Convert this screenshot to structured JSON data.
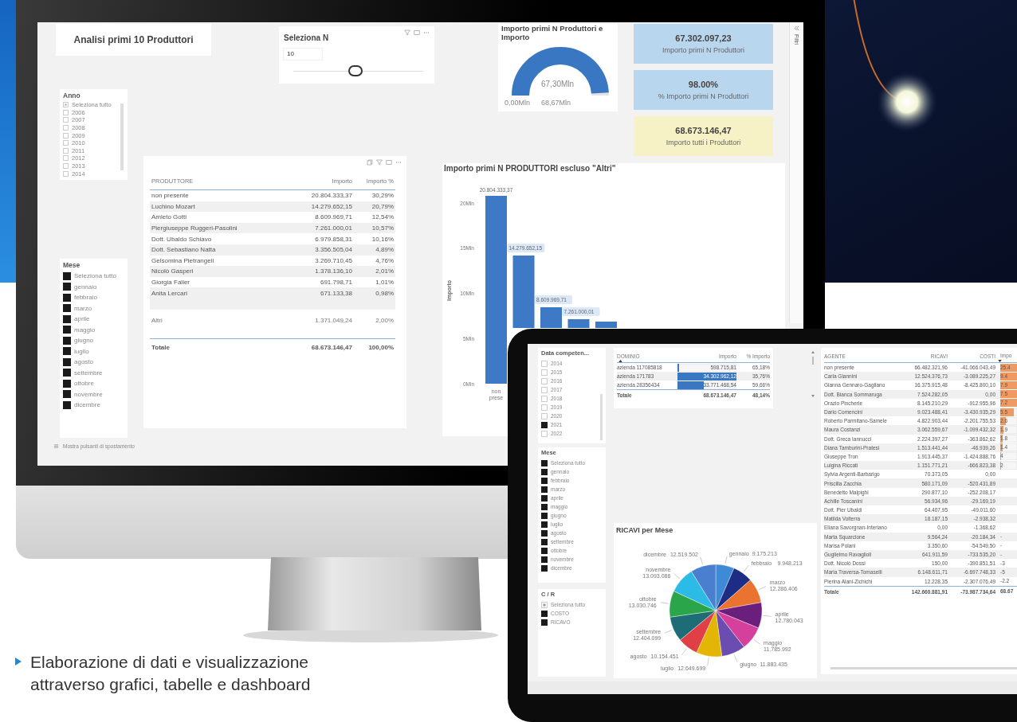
{
  "monitor": {
    "title_card": "Analisi primi 10 Produttori",
    "n_selector": {
      "title": "Seleziona N",
      "value": "10",
      "level": 0.48
    },
    "gauge": {
      "title": "Importo primi N Produttori e Importo",
      "value": "67,30Mln",
      "min": "0,00Mln",
      "max": "68,67Mln",
      "level": 0.98
    },
    "kpi_cards": [
      {
        "value": "67.302.097,23",
        "label": "Importo primi N Produttori",
        "kind": "partial"
      },
      {
        "value": "98.00%",
        "label": "% Importo primi N Produttori",
        "kind": "partial"
      },
      {
        "value": "68.673.146,47",
        "label": "Importo tutti i Produttori",
        "kind": "total"
      }
    ],
    "filters_pane": {
      "label": "Filtri"
    },
    "year_slicer": {
      "title": "Anno",
      "items": [
        {
          "label": "Seleziona tutto",
          "checked": false,
          "indeterminate": true
        },
        {
          "label": "2006",
          "checked": false,
          "indeterminate": false
        },
        {
          "label": "2007",
          "checked": false,
          "indeterminate": false
        },
        {
          "label": "2008",
          "checked": false,
          "indeterminate": false
        },
        {
          "label": "2009",
          "checked": false,
          "indeterminate": false
        },
        {
          "label": "2010",
          "checked": false,
          "indeterminate": false
        },
        {
          "label": "2011",
          "checked": false,
          "indeterminate": false
        },
        {
          "label": "2012",
          "checked": false,
          "indeterminate": false
        },
        {
          "label": "2013",
          "checked": false,
          "indeterminate": false
        },
        {
          "label": "2014",
          "checked": false,
          "indeterminate": false
        }
      ]
    },
    "month_slicer": {
      "title": "Mese",
      "items": [
        {
          "label": "Seleziona tutto",
          "checked": true
        },
        {
          "label": "gennaio",
          "checked": true
        },
        {
          "label": "febbraio",
          "checked": true
        },
        {
          "label": "marzo",
          "checked": true
        },
        {
          "label": "aprile",
          "checked": true
        },
        {
          "label": "maggio",
          "checked": true
        },
        {
          "label": "giugno",
          "checked": true
        },
        {
          "label": "luglio",
          "checked": true
        },
        {
          "label": "agosto",
          "checked": true
        },
        {
          "label": "settembre",
          "checked": true
        },
        {
          "label": "ottobre",
          "checked": true
        },
        {
          "label": "novembre",
          "checked": true
        },
        {
          "label": "dicembre",
          "checked": true
        }
      ]
    },
    "table": {
      "columns": [
        "PRODUTTORE",
        "Importo",
        "Importo %"
      ],
      "rows": [
        [
          "non presente",
          "20.804.333,37",
          "30,29%"
        ],
        [
          "Luchino Mozart",
          "14.279.652,15",
          "20,79%"
        ],
        [
          "Amleto Gotti",
          "8.609.969,71",
          "12,54%"
        ],
        [
          "Piergiuseppe Ruggeri-Pasolini",
          "7.261.000,01",
          "10,57%"
        ],
        [
          "Dott. Ubaldo Schiavo",
          "6.979.858,31",
          "10,16%"
        ],
        [
          "Dott. Sebastiano Natta",
          "3.356.505,04",
          "4,89%"
        ],
        [
          "Gelsomina Pietrangeli",
          "3.269.710,45",
          "4,76%"
        ],
        [
          "Nicolò Gasperi",
          "1.378.136,10",
          "2,01%"
        ],
        [
          "Giorgia Falier",
          "691.798,71",
          "1,01%"
        ],
        [
          "Anita Lercari",
          "671.133,38",
          "0,98%"
        ]
      ],
      "others_row": [
        "Altri",
        "1.371.049,24",
        "2,00%"
      ],
      "total_row": [
        "Totale",
        "68.673.146,47",
        "100,00%"
      ]
    },
    "bar_chart": {
      "title": "Importo primi N PRODUTTORI escluso \"Altri\"",
      "ylabel": "Importo",
      "axis_labels": [
        "20Mln",
        "15Mln",
        "10Mln",
        "5Mln",
        "0Mln"
      ],
      "bar_labels": [
        "20.804.333,37",
        "14.279.652,15",
        "8.609.969,71",
        "7.261.000,01"
      ],
      "category_label": "non prese"
    },
    "footer": "Mostra pulsanti di spostamento"
  },
  "tablet": {
    "year_slicer": {
      "title": "Data competen...",
      "items": [
        {
          "label": "2014",
          "checked": false
        },
        {
          "label": "2015",
          "checked": false
        },
        {
          "label": "2016",
          "checked": false
        },
        {
          "label": "2017",
          "checked": false
        },
        {
          "label": "2018",
          "checked": false
        },
        {
          "label": "2019",
          "checked": false
        },
        {
          "label": "2020",
          "checked": false
        },
        {
          "label": "2021",
          "checked": true
        },
        {
          "label": "2022",
          "checked": false
        }
      ]
    },
    "month_slicer": {
      "title": "Mese",
      "items": [
        {
          "label": "Seleziona tutto",
          "checked": true
        },
        {
          "label": "gennaio",
          "checked": true
        },
        {
          "label": "febbraio",
          "checked": true
        },
        {
          "label": "marzo",
          "checked": true
        },
        {
          "label": "aprile",
          "checked": true
        },
        {
          "label": "maggio",
          "checked": true
        },
        {
          "label": "giugno",
          "checked": true
        },
        {
          "label": "luglio",
          "checked": true
        },
        {
          "label": "agosto",
          "checked": true
        },
        {
          "label": "settembre",
          "checked": true
        },
        {
          "label": "ottobre",
          "checked": true
        },
        {
          "label": "novembre",
          "checked": true
        },
        {
          "label": "dicembre",
          "checked": true
        }
      ]
    },
    "cr_slicer": {
      "title": "C / R",
      "items": [
        {
          "label": "Seleziona tutto",
          "checked": false,
          "indeterminate": true
        },
        {
          "label": "COSTO",
          "checked": true,
          "indeterminate": false
        },
        {
          "label": "RICAVO",
          "checked": true,
          "indeterminate": false
        }
      ]
    },
    "domain_table": {
      "columns": [
        "DOMINIO",
        "Importo",
        "% Importo"
      ],
      "rows": [
        {
          "cells": [
            "azienda 117085818",
            "598.715,81",
            "65,18%"
          ],
          "level": 0.03
        },
        {
          "cells": [
            "azienda 171783",
            "34.302.962,12",
            "35,76%"
          ],
          "level": 1
        },
        {
          "cells": [
            "azienda 28356434",
            "33.771.468,54",
            "59,66%"
          ],
          "level": 0.45
        }
      ],
      "total_row": [
        "Totale",
        "68.673.146,47",
        "48,14%"
      ]
    },
    "agent_table": {
      "columns": [
        "AGENTE",
        "RICAVI",
        "COSTI",
        "Impo"
      ],
      "rows": [
        {
          "cells": [
            "non presente",
            "66.482.321,96",
            "-41.066.043,49"
          ],
          "column_4": "25.4",
          "level": 1
        },
        {
          "cells": [
            "Carla Giannini",
            "12.524.376,73",
            "-3.089.225,27"
          ],
          "column_4": "9.4",
          "level": 1
        },
        {
          "cells": [
            "Gianna Gennaro-Gagliano",
            "16.375.915,48",
            "-8.425.800,10"
          ],
          "column_4": "7.9",
          "level": 1
        },
        {
          "cells": [
            "Dott. Bianca Sommaruga",
            "7.524.282,05",
            "0,00"
          ],
          "column_4": "7.5",
          "level": 1
        },
        {
          "cells": [
            "Orazio Pincherle",
            "8.145.210,29",
            "-912.955,96"
          ],
          "column_4": "7.2",
          "level": 1
        },
        {
          "cells": [
            "Dario Comencini",
            "9.023.488,41",
            "-3.430.935,29"
          ],
          "column_4": "5.5",
          "level": 0.8
        },
        {
          "cells": [
            "Roberto Parmitano-Samele",
            "4.822.903,44",
            "-2.201.755,53"
          ],
          "column_4": "2.6",
          "level": 0.35
        },
        {
          "cells": [
            "Maura Costanzi",
            "3.062.559,67",
            "-1.099.432,32"
          ],
          "column_4": "1.9",
          "level": 0.2
        },
        {
          "cells": [
            "Dott. Greca Iannucci",
            "2.224.397,27",
            "-363.862,62"
          ],
          "column_4": "1.8",
          "level": 0.15
        },
        {
          "cells": [
            "Diana Tamburini-Pratesi",
            "1.513.441,44",
            "-46.939,26"
          ],
          "column_4": "1.4",
          "level": 0.12
        },
        {
          "cells": [
            "Giuseppe Tron",
            "1.913.445,37",
            "-1.424.888,76"
          ],
          "column_4": "4",
          "level": 0.06
        },
        {
          "cells": [
            "Luigina Riccati",
            "1.151.771,21",
            "-666.823,38"
          ],
          "column_4": "2",
          "level": 0.04
        },
        {
          "cells": [
            "Sylvia Argenti-Barbarigo",
            "70.373,05",
            "0,00"
          ]
        },
        {
          "cells": [
            "Priscilla Zacchia",
            "580.171,09",
            "-520.431,89"
          ]
        },
        {
          "cells": [
            "Benedetto Malpighi",
            "290.877,10",
            "-252.208,17"
          ]
        },
        {
          "cells": [
            "Achille Toscanini",
            "56.934,96",
            "-29.169,19"
          ]
        },
        {
          "cells": [
            "Dott. Pier Ubaldi",
            "64.407,95",
            "-49.011,60"
          ]
        },
        {
          "cells": [
            "Matilda Volterra",
            "18.187,15",
            "-2.938,32"
          ]
        },
        {
          "cells": [
            "Eliana Savorgnan-Interiano",
            "0,00",
            "-1.368,62"
          ]
        },
        {
          "cells": [
            "Marta Squarcione",
            "9.564,24",
            "-20.184,34"
          ],
          "column_4": "-"
        },
        {
          "cells": [
            "Marisa Polani",
            "3.350,60",
            "-54.549,50"
          ],
          "column_4": "-"
        },
        {
          "cells": [
            "Guglielmo Ravaglioli",
            "641.911,59",
            "-733.535,20"
          ],
          "column_4": "-"
        },
        {
          "cells": [
            "Dott. Nicolò Dossi",
            "150,00",
            "-390.851,51"
          ],
          "column_4": "-3"
        },
        {
          "cells": [
            "Maria Traversa-Tomaselli",
            "6.148.611,71",
            "-6.697.748,33"
          ],
          "column_4": "-5"
        },
        {
          "cells": [
            "Pierina Alani-Zichichi",
            "12.228,35",
            "-2.307.076,49"
          ],
          "column_4": "-2.2"
        }
      ],
      "total_row": [
        "Totale",
        "142.660.881,91",
        "-73.987.734,64",
        "68.67"
      ]
    },
    "pie": {
      "chart_data": {
        "type": "pie",
        "title": "RICAVI per Mese",
        "categories": [
          "gennaio",
          "febbraio",
          "marzo",
          "aprile",
          "maggio",
          "giugno",
          "luglio",
          "agosto",
          "settembre",
          "ottobre",
          "novembre",
          "dicembre"
        ],
        "values": [
          9175213,
          9948213,
          12286406,
          12780043,
          11785992,
          11883435,
          12649699,
          10154451,
          12404099,
          13030746,
          13093086,
          12519502
        ],
        "value_labels": [
          "9.175.213",
          "9.948.213",
          "12.286.406",
          "12.780.043",
          "11.785.992",
          "11.883.435",
          "12.649.699",
          "10.154.451",
          "12.404.099",
          "13.030.746",
          "13.093.086",
          "12.519.502"
        ],
        "colors": [
          "#3d8ad6",
          "#1d2d86",
          "#ea7330",
          "#6a1f7c",
          "#d4409c",
          "#6a4dae",
          "#e3b505",
          "#df3f45",
          "#1e6c76",
          "#2aa54a",
          "#2cbbe6",
          "#4a7fcf"
        ]
      }
    }
  },
  "caption": "Elaborazione di dati e visualizzazione attraverso grafici, tabelle e dashboard"
}
